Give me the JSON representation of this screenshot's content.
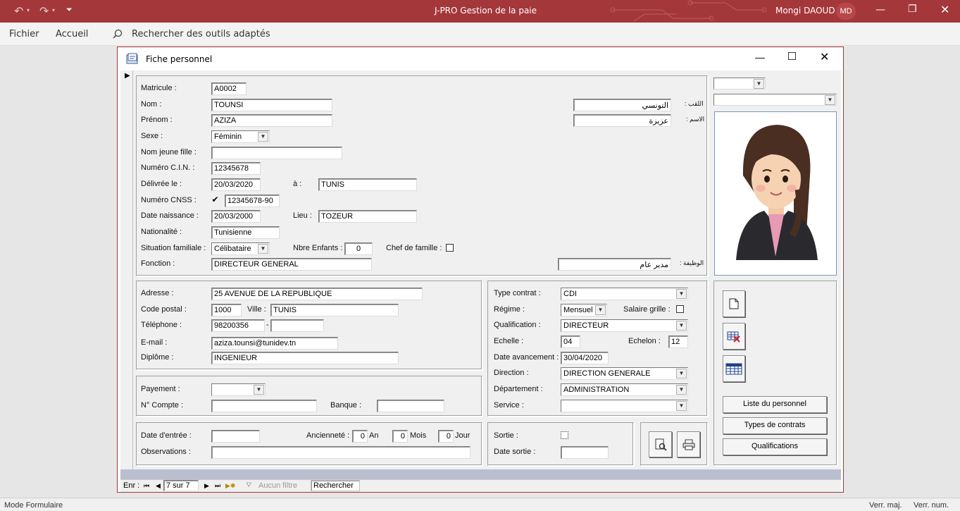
{
  "app": {
    "title": "J-PRO Gestion de la paie",
    "user_name": "Mongi DAOUD",
    "user_initials": "MD",
    "accent": "#a4373a"
  },
  "ribbon": {
    "file": "Fichier",
    "home": "Accueil",
    "search_placeholder": "Rechercher des outils adaptés"
  },
  "status": {
    "mode": "Mode Formulaire",
    "caps": "Verr. maj.",
    "num": "Verr. num."
  },
  "window": {
    "title": "Fiche personnel"
  },
  "identity": {
    "matricule_label": "Matricule :",
    "matricule": "A0002",
    "nom_label": "Nom :",
    "nom": "TOUNSI",
    "prenom_label": "Prénom :",
    "prenom": "AZIZA",
    "sexe_label": "Sexe :",
    "sexe": "Féminin",
    "nom_jf_label": "Nom jeune fille :",
    "nom_jf": "",
    "cin_label": "Numéro C.I.N. :",
    "cin": "12345678",
    "delivree_label": "Délivrée le :",
    "delivree": "20/03/2020",
    "a_label": "à :",
    "a_lieu": "TUNIS",
    "cnss_label": "Numéro CNSS :",
    "cnss_checked": "✔",
    "cnss": "12345678-90",
    "naissance_label": "Date naissance :",
    "naissance": "20/03/2000",
    "lieu_label": "Lieu :",
    "lieu": "TOZEUR",
    "nationalite_label": "Nationalité :",
    "nationalite": "Tunisienne",
    "situation_label": "Situation familiale :",
    "situation": "Célibataire",
    "enfants_label": "Nbre Enfants :",
    "enfants": "0",
    "chef_label": "Chef de famille :",
    "fonction_label": "Fonction :",
    "fonction": "DIRECTEUR GENERAL",
    "ar_nom_label": "اللقب :",
    "ar_nom": "التونسي",
    "ar_prenom_label": "الاسم :",
    "ar_prenom": "عزيزة",
    "ar_fonction_label": "الوظيفة :",
    "ar_fonction": "مدير عام"
  },
  "contact": {
    "adresse_label": "Adresse :",
    "adresse": "25 AVENUE DE LA REPUBLIQUE",
    "cp_label": "Code postal :",
    "cp": "1000",
    "ville_label": "Ville :",
    "ville": "TUNIS",
    "tel_label": "Téléphone :",
    "tel": "98200356",
    "tel_sep": "-",
    "tel2": "",
    "email_label": "E-mail :",
    "email": "aziza.tounsi@tunidev.tn",
    "diplome_label": "Diplôme :",
    "diplome": "INGENIEUR"
  },
  "payment": {
    "payement_label": "Payement :",
    "payement": "",
    "compte_label": "N° Compte :",
    "compte": "",
    "banque_label": "Banque :",
    "banque": ""
  },
  "dates": {
    "entree_label": "Date d'entrée :",
    "entree": "",
    "anciennete_label": "Ancienneté :",
    "an": "0",
    "an_unit": "An",
    "mois": "0",
    "mois_unit": "Mois",
    "jour": "0",
    "jour_unit": "Jour",
    "obs_label": "Observations :",
    "obs": ""
  },
  "contract": {
    "type_label": "Type contrat :",
    "type": "CDI",
    "regime_label": "Régime :",
    "regime": "Mensuel",
    "grille_label": "Salaire grille :",
    "qualif_label": "Qualification :",
    "qualif": "DIRECTEUR",
    "echelle_label": "Echelle :",
    "echelle": "04",
    "echelon_label": "Echelon :",
    "echelon": "12",
    "avancement_label": "Date avancement :",
    "avancement": "30/04/2020",
    "direction_label": "Direction :",
    "direction": "DIRECTION GENERALE",
    "departement_label": "Département :",
    "departement": "ADMINISTRATION",
    "service_label": "Service :",
    "service": ""
  },
  "exit": {
    "sortie_label": "Sortie :",
    "date_sortie_label": "Date sortie :",
    "date_sortie": ""
  },
  "side": {
    "liste": "Liste du personnel",
    "types": "Types de contrats",
    "qualifs": "Qualifications"
  },
  "nav": {
    "label": "Enr :",
    "position": "7 sur 7",
    "filter": "Aucun filtre",
    "search": "Rechercher"
  }
}
